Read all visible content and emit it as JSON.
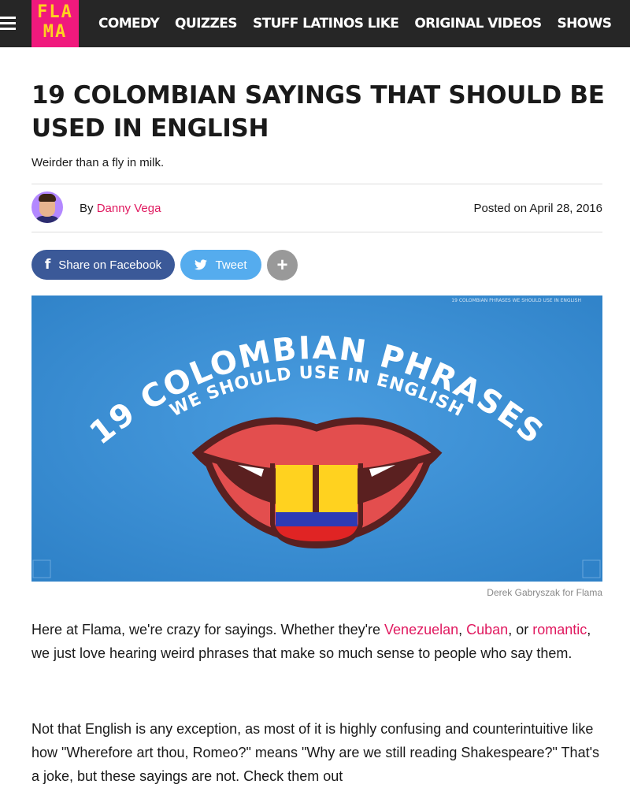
{
  "nav": {
    "logo_line1": "FLA",
    "logo_line2": "MA",
    "items": [
      "COMEDY",
      "QUIZZES",
      "STUFF LATINOS LIKE",
      "ORIGINAL VIDEOS",
      "SHOWS"
    ]
  },
  "article": {
    "title": "19 COLOMBIAN SAYINGS THAT SHOULD BE USED IN ENGLISH",
    "subtitle": "Weirder than a fly in milk.",
    "by_prefix": "By",
    "author": "Danny Vega",
    "posted": "Posted on April 28, 2016"
  },
  "share": {
    "facebook": "Share on Facebook",
    "tweet": "Tweet",
    "more": "+"
  },
  "hero": {
    "line1": "19 COLOMBIAN PHRASES",
    "line2": "WE SHOULD USE IN ENGLISH",
    "watermark": "19 COLOMBIAN PHRASES WE SHOULD USE IN ENGLISH",
    "credit": "Derek Gabryszak for Flama"
  },
  "body": {
    "p1": {
      "t1": "Here at Flama, we're crazy for sayings. Whether they're ",
      "l1": "Venezuelan",
      "t2": ", ",
      "l2": "Cuban",
      "t3": ", or ",
      "l3": "romantic",
      "t4": ", we just love hearing weird phrases that make so much sense to people who say them."
    },
    "p2": "Not that English is any exception, as most of it is highly confusing and counterintuitive like how \"Wherefore art thou, Romeo?\" means \"Why are we still reading Shakespeare?\" That's a joke, but these sayings are not. Check them out"
  },
  "colors": {
    "nav_bg": "#262626",
    "logo_bg": "#f0197d",
    "logo_fg": "#ffd21f",
    "link": "#e0195f",
    "facebook": "#3b5998",
    "twitter": "#55acee",
    "hero_blue": "#3b8fd6"
  }
}
